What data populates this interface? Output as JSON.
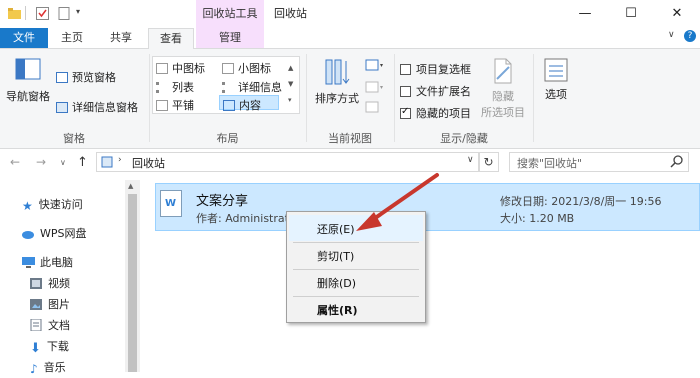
{
  "titlebar": {
    "contextual_tab": "回收站工具",
    "window_title": "回收站",
    "minimize": "—",
    "maximize": "☐",
    "close": "✕"
  },
  "tabs": {
    "file": "文件",
    "home": "主页",
    "share": "共享",
    "view": "查看",
    "manage": "管理"
  },
  "ribbon": {
    "pane": {
      "nav_pane": "导航窗格",
      "preview_pane": "预览窗格",
      "details_pane": "详细信息窗格",
      "group_label": "窗格"
    },
    "layout": {
      "medium_icons": "中图标",
      "small_icons": "小图标",
      "list": "列表",
      "details": "详细信息",
      "tiles": "平铺",
      "content": "内容",
      "group_label": "布局"
    },
    "current_view": {
      "sort_by": "排序方式",
      "group_label": "当前视图"
    },
    "show_hide": {
      "item_checkboxes": "项目复选框",
      "file_extensions": "文件扩展名",
      "hidden_items": "隐藏的项目",
      "hide_selected_l1": "隐藏",
      "hide_selected_l2": "所选项目",
      "group_label": "显示/隐藏",
      "item_checkboxes_checked": false,
      "file_extensions_checked": false,
      "hidden_items_checked": true
    },
    "options": {
      "label": "选项"
    }
  },
  "address": {
    "path": "回收站",
    "search_placeholder": "搜索\"回收站\""
  },
  "navpane": {
    "items": [
      {
        "label": "快速访问",
        "icon": "star-icon"
      },
      {
        "label": "WPS网盘",
        "icon": "cloud-icon"
      },
      {
        "label": "此电脑",
        "icon": "computer-icon"
      },
      {
        "label": "视频",
        "icon": "video-icon"
      },
      {
        "label": "图片",
        "icon": "picture-icon"
      },
      {
        "label": "文档",
        "icon": "document-icon"
      },
      {
        "label": "下载",
        "icon": "download-icon"
      },
      {
        "label": "音乐",
        "icon": "music-icon"
      }
    ]
  },
  "file": {
    "name": "文案分享",
    "author": "作者: Administrator",
    "modified": "修改日期: 2021/3/8/周一 19:56",
    "size": "大小: 1.20 MB"
  },
  "context_menu": {
    "restore": "还原(E)",
    "cut": "剪切(T)",
    "delete": "删除(D)",
    "properties": "属性(R)"
  },
  "colors": {
    "accent": "#1979ca",
    "contextual_tab": "#f7dffc",
    "selection": "#cce8ff",
    "arrow": "#c8372d"
  }
}
